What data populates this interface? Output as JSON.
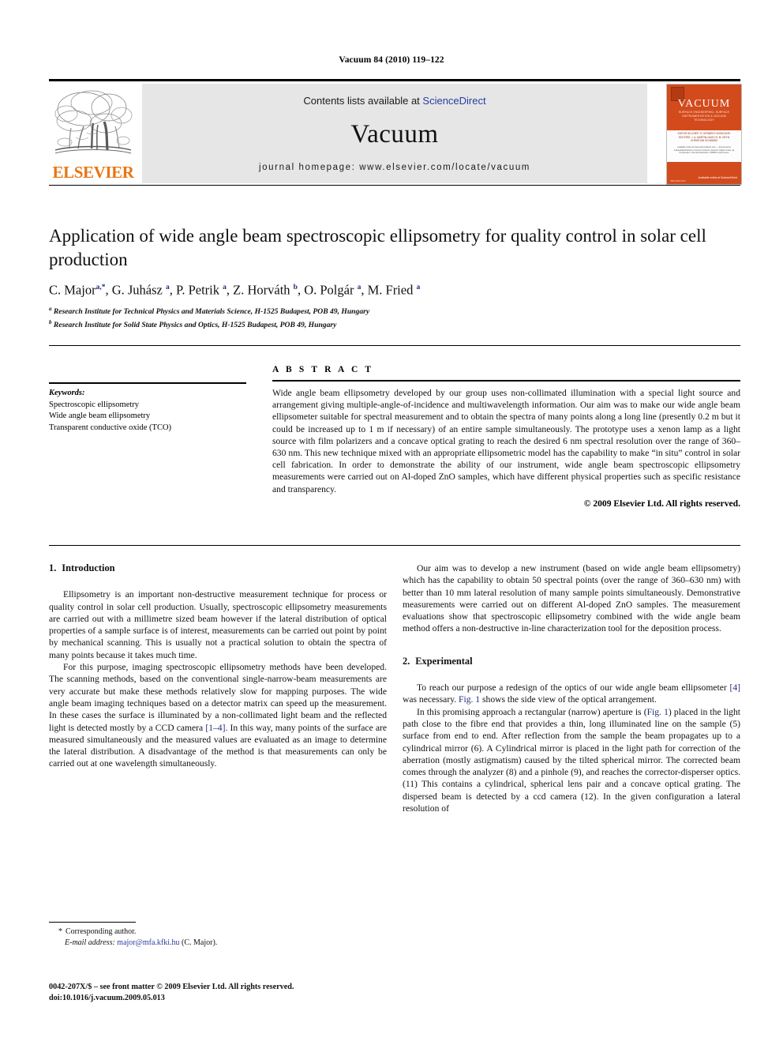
{
  "running_head": "Vacuum 84 (2010) 119–122",
  "masthead": {
    "publisher_name": "ELSEVIER",
    "contents_prefix": "Contents lists available at ",
    "contents_link": "ScienceDirect",
    "journal_name": "Vacuum",
    "homepage": "journal homepage: www.elsevier.com/locate/vacuum",
    "cover": {
      "title": "VACUUM",
      "subtitle": "SURFACE ENGINEERING, SURFACE INSTRUMENTATION & VACUUM TECHNOLOGY",
      "editors": "EDITOR-IN-CHIEF:  R. KENNEDY   ASSOCIATE EDITORS:  J. A. MARTIN-GAGO   H. M. HEYN   CHRISTIAN SCHWARZ",
      "blurb": "Available online at www.sciencedirect.com — this journal is indexed/abstracted in Current Contents, Science Citation Index, Ei Compendex, Chemical Abstracts, INSPEC and Scopus.",
      "sciencedirect": "Available online at\nScienceDirect",
      "bottom_left": "ISSN 0042-207X"
    }
  },
  "article": {
    "title": "Application of wide angle beam spectroscopic ellipsometry for quality control in solar cell production",
    "authors_html": "C. Major<sup>a,*</sup>, G. Juhász <sup>a</sup>, P. Petrik <sup>a</sup>, Z. Horváth <sup>b</sup>, O. Polgár <sup>a</sup>, M. Fried <sup>a</sup>",
    "affiliation_a": "Research Institute for Technical Physics and Materials Science, H-1525 Budapest, POB 49, Hungary",
    "affiliation_b": "Research Institute for Solid State Physics and Optics, H-1525 Budapest, POB 49, Hungary"
  },
  "keywords": {
    "heading": "Keywords:",
    "items": [
      "Spectroscopic ellipsometry",
      "Wide angle beam ellipsometry",
      "Transparent conductive oxide (TCO)"
    ]
  },
  "abstract": {
    "label": "A B S T R A C T",
    "text": "Wide angle beam ellipsometry developed by our group uses non-collimated illumination with a special light source and arrangement giving multiple-angle-of-incidence and multiwavelength information. Our aim was to make our wide angle beam ellipsometer suitable for spectral measurement and to obtain the spectra of many points along a long line (presently 0.2 m but it could be increased up to 1 m if necessary) of an entire sample simultaneously. The prototype uses a xenon lamp as a light source with film polarizers and a concave optical grating to reach the desired 6 nm spectral resolution over the range of 360–630 nm. This new technique mixed with an appropriate ellipsometric model has the capability to make “in situ” control in solar cell fabrication. In order to demonstrate the ability of our instrument, wide angle beam spectroscopic ellipsometry measurements were carried out on Al-doped ZnO samples, which have different physical properties such as specific resistance and transparency.",
    "copyright": "© 2009 Elsevier Ltd. All rights reserved."
  },
  "sections": {
    "introduction": {
      "number": "1.",
      "title": "Introduction",
      "paragraphs": [
        "Ellipsometry is an important non-destructive measurement technique for process or quality control in solar cell production. Usually, spectroscopic ellipsometry measurements are carried out with a millimetre sized beam however if the lateral distribution of optical properties of a sample surface is of interest, measurements can be carried out point by point by mechanical scanning. This is usually not a practical solution to obtain the spectra of many points because it takes much time.",
        "For this purpose, imaging spectroscopic ellipsometry methods have been developed. The scanning methods, based on the conventional single-narrow-beam measurements are very accurate but make these methods relatively slow for mapping purposes. The wide angle beam imaging techniques based on a detector matrix can speed up the measurement. In these cases the surface is illuminated by a non-collimated light beam and the reflected light is detected mostly by a CCD camera [1–4]. In this way, many points of the surface are measured simultaneously and the measured values are evaluated as an image to determine the lateral distribution. A disadvantage of the method is that measurements can only be carried out at one wavelength simultaneously.",
        "Our aim was to develop a new instrument (based on wide angle beam ellipsometry) which has the capability to obtain 50 spectral points (over the range of 360–630 nm) with better than 10 mm lateral resolution of many sample points simultaneously. Demonstrative measurements were carried out on different Al-doped ZnO samples. The measurement evaluations show that spectroscopic ellipsometry combined with the wide angle beam method offers a non-destructive in-line characterization tool for the deposition process."
      ]
    },
    "experimental": {
      "number": "2.",
      "title": "Experimental",
      "paragraphs": [
        "To reach our purpose a redesign of the optics of our wide angle beam ellipsometer [4] was necessary. Fig. 1 shows the side view of the optical arrangement.",
        "In this promising approach a rectangular (narrow) aperture is (Fig. 1) placed in the light path close to the fibre end that provides a thin, long illuminated line on the sample (5) surface from end to end. After reflection from the sample the beam propagates up to a cylindrical mirror (6). A Cylindrical mirror is placed in the light path for correction of the aberration (mostly astigmatism) caused by the tilted spherical mirror. The corrected beam comes through the analyzer (8) and a pinhole (9), and reaches the corrector-disperser optics. (11) This contains a cylindrical, spherical lens pair and a concave optical grating. The dispersed beam is detected by a ccd camera (12). In the given configuration a lateral resolution of"
      ]
    }
  },
  "footnotes": {
    "corresponding_marker": "*",
    "corresponding_text": "Corresponding author.",
    "email_label": "E-mail address:",
    "email": "major@mfa.kfki.hu",
    "email_suffix": "(C. Major).",
    "issn_line": "0042-207X/$ – see front matter © 2009 Elsevier Ltd. All rights reserved.",
    "doi_line": "doi:10.1016/j.vacuum.2009.05.013"
  },
  "colors": {
    "elsevier_orange": "#E87511",
    "link_blue": "#2b3c9e",
    "cover_orange": "#D34B1C",
    "band_gray": "#e6e6e6"
  }
}
